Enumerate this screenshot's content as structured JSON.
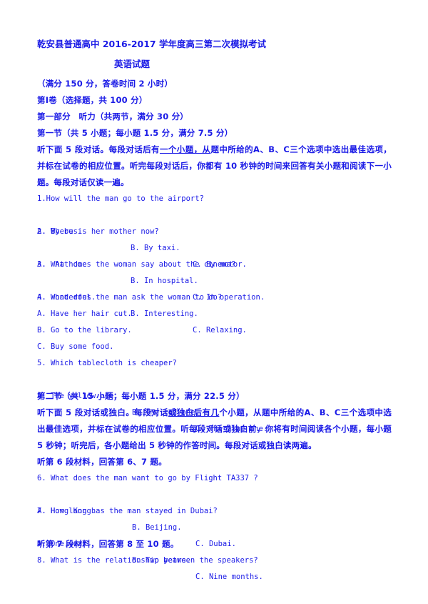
{
  "document": {
    "title": "乾安县普通高中 2016-2017 学年度高三第二次模拟考试",
    "subject": "英语试题",
    "score_note": "（满分 150 分，答卷时间 2 小时）",
    "paper_section": "第Ⅰ卷（选择题，共 100 分）",
    "part_one": "第一部分　听力（共两节，满分 30 分）"
  },
  "section_one": {
    "heading": "第一节（共 5 小题；每小题 1.5 分，满分 7.5 分）",
    "instructions": {
      "pre": "听下面 5 段对话。每段对话后有",
      "underlined": "一个小题，从",
      "post": "题中所给的A、B、C三个选项中选出最佳选项，并标在试卷的相应位置。听完每段对话后，你都有 10 秒钟的时间来回答有关小题和阅读下一小题。每段对话仅读一遍。"
    },
    "questions": [
      {
        "number": "1.",
        "text": "1.How will the man go to the airport?",
        "options": [
          "A. By bus.",
          "B. By taxi.",
          "C. By motor."
        ],
        "layout": "row"
      },
      {
        "number": "2.",
        "text": "2. Where is her mother now?",
        "options": [
          "A.  At home",
          "B. In hospital.",
          "C. In operation."
        ],
        "layout": "row"
      },
      {
        "number": "3.",
        "text": "3. What does the woman say about the cinema?",
        "options": [
          "A. Wonderful.",
          "B. Interesting.",
          "C. Relaxing."
        ],
        "layout": "row"
      },
      {
        "number": "4.",
        "text": "4. What does the man ask the woman to do?",
        "options": [
          "A. Have her hair cut.",
          "B. Go to the library.",
          "C. Buy some food."
        ],
        "layout": "stacked"
      },
      {
        "number": "5.",
        "text": "5. Which tablecloth is cheaper?",
        "options": [
          "A. The yellow one.",
          "B. The red one.",
          "C. The blue one."
        ],
        "layout": "row"
      }
    ]
  },
  "section_two": {
    "heading": "第二节（共 15 小题；每小题 1.5 分，满分 22.5 分）",
    "instructions": {
      "pre": "听下面 5 段对话或独白。每段对话",
      "underlined": "或独白后有几",
      "post": "个小题，从题中所给的A、B、C三个选项中选出最佳选项，并标在试卷的相应位置。听每段对话或独白前，你将有时间阅读各个小题，每小题 5 秒钟；听完后，各小题给出 5 秒钟的作答时间。每段对话或独白读两遍。"
    },
    "material_6": "听第 6 段材料，回答第 6、7 题。",
    "questions_6_7": [
      {
        "text": "6. What does the man want to go by Flight TA337 ?",
        "options": [
          "A. Hong Kong.",
          "B. Beijing.",
          "C. Dubai."
        ]
      },
      {
        "text": "7. How long has the man stayed in Dubai?",
        "options": [
          "A. One year.",
          "B. Two years.",
          "C. Nine months."
        ]
      }
    ],
    "material_7": "听第 7 段材料，回答第 8 至 10 题。",
    "question_8": "8. What is the relationship between the speakers?"
  },
  "colors": {
    "text": "#1a1ae6",
    "background": "#ffffff"
  }
}
